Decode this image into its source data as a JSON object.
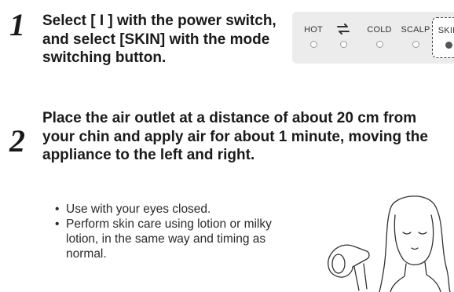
{
  "steps": [
    {
      "number": "1",
      "text": "Select [ I ] with the power switch, and select [SKIN] with the mode switching button."
    },
    {
      "number": "2",
      "text": "Place the air outlet at a distance of about 20 cm from your chin and apply air for about 1 minute, moving the appliance to the left and right."
    }
  ],
  "mode_panel": {
    "modes": [
      {
        "label": "HOT",
        "active": false
      },
      {
        "label": "",
        "icon": "alternating-arrows-icon",
        "active": false
      },
      {
        "label": "COLD",
        "active": false
      },
      {
        "label": "SCALP",
        "active": false
      },
      {
        "label": "SKIN",
        "active": true
      }
    ]
  },
  "notes": [
    "Use with your eyes closed.",
    "Perform skin care using lotion or milky lotion, in the same way and timing as normal."
  ]
}
